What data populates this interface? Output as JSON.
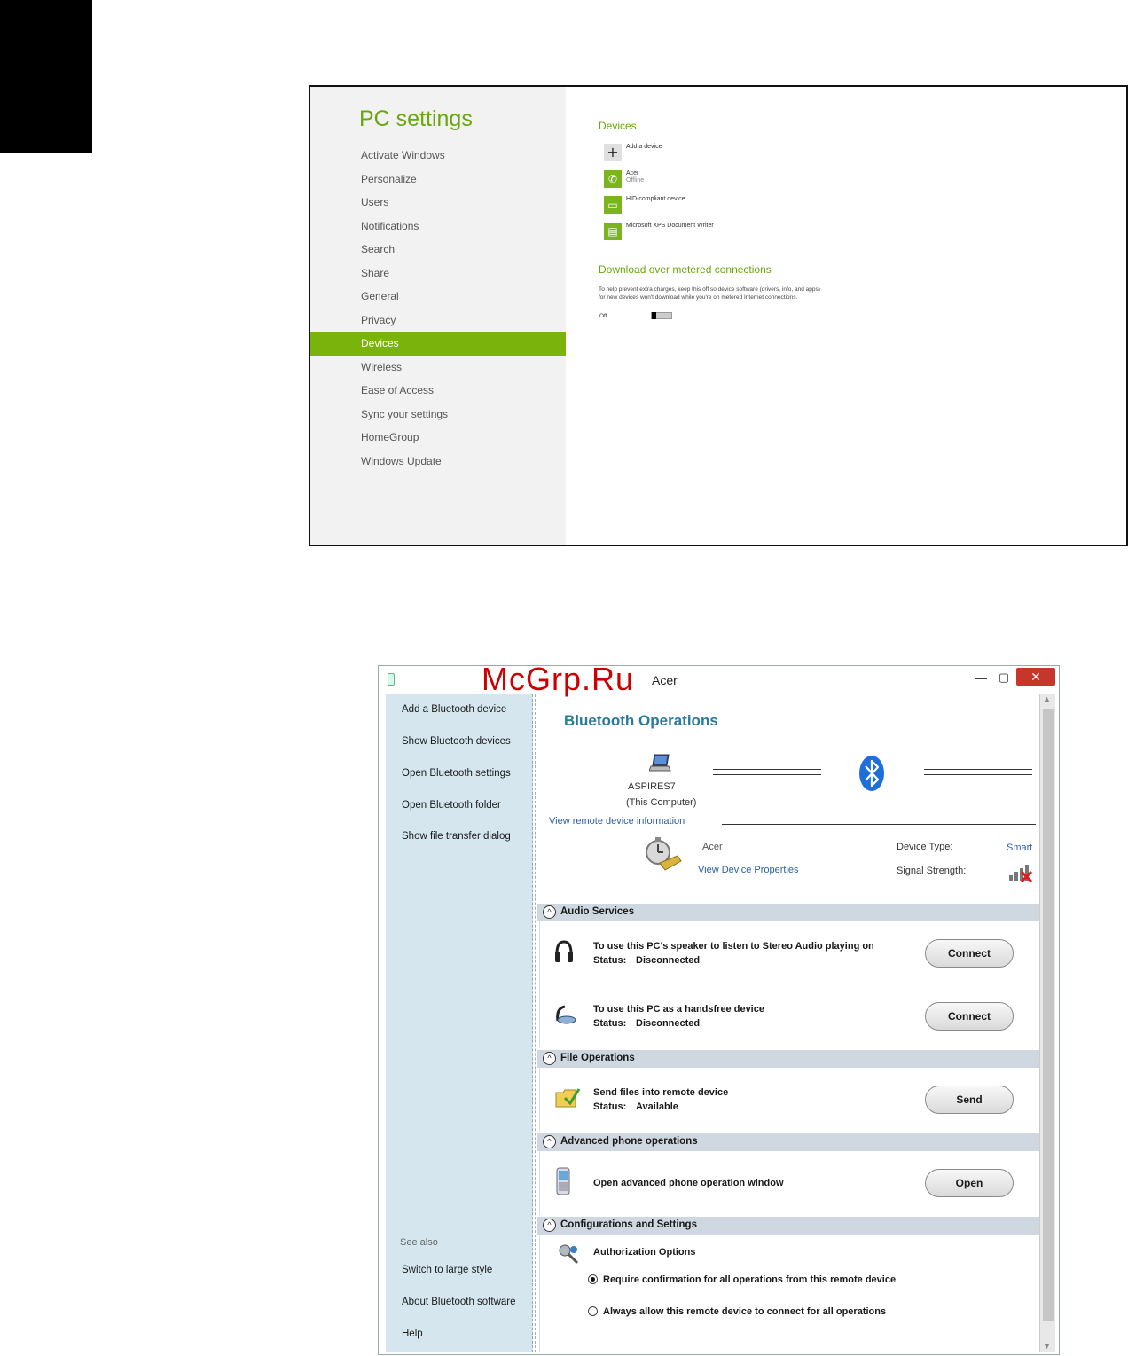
{
  "pc_settings": {
    "title": "PC settings",
    "nav": [
      "Activate Windows",
      "Personalize",
      "Users",
      "Notifications",
      "Search",
      "Share",
      "General",
      "Privacy",
      "Devices",
      "Wireless",
      "Ease of Access",
      "Sync your settings",
      "HomeGroup",
      "Windows Update"
    ],
    "active": "Devices",
    "devices_heading": "Devices",
    "devices": [
      {
        "name": "Add a device",
        "sub": ""
      },
      {
        "name": "Acer",
        "sub": "Offline"
      },
      {
        "name": "HID-compliant device",
        "sub": ""
      },
      {
        "name": "Microsoft XPS Document Writer",
        "sub": ""
      }
    ],
    "metered_heading": "Download over metered connections",
    "metered_text": "To help prevent extra charges, keep this off so device software (drivers, info, and apps) for new devices won't download while you're on metered Internet connections.",
    "toggle_label": "Off"
  },
  "watermark": "McGrp.Ru",
  "bluetooth": {
    "window_title": "Acer",
    "sidebar": {
      "links": [
        "Add a Bluetooth device",
        "Show Bluetooth devices",
        "Open Bluetooth settings",
        "Open Bluetooth folder",
        "Show file transfer dialog"
      ],
      "see_also": "See also",
      "see_also_links": [
        "Switch to large style",
        "About Bluetooth software",
        "Help"
      ]
    },
    "main": {
      "title": "Bluetooth Operations",
      "computer_name": "ASPIRES7",
      "computer_sub": "(This Computer)",
      "remote_info_link": "View remote device information",
      "remote_name": "Acer",
      "device_properties_link": "View Device Properties",
      "device_type_label": "Device Type:",
      "device_type_value": "Smart",
      "signal_label": "Signal Strength:"
    },
    "sections": {
      "audio": {
        "title": "Audio Services",
        "items": [
          {
            "text": "To use this PC's speaker to listen to Stereo Audio playing on",
            "status_label": "Status:",
            "status": "Disconnected",
            "button": "Connect"
          },
          {
            "text": "To use this PC as a handsfree device",
            "status_label": "Status:",
            "status": "Disconnected",
            "button": "Connect"
          }
        ]
      },
      "file": {
        "title": "File Operations",
        "items": [
          {
            "text": "Send files into remote device",
            "status_label": "Status:",
            "status": "Available",
            "button": "Send"
          }
        ]
      },
      "phone": {
        "title": "Advanced phone operations",
        "items": [
          {
            "text": "Open advanced phone operation window",
            "button": "Open"
          }
        ]
      },
      "config": {
        "title": "Configurations and Settings",
        "auth_title": "Authorization Options",
        "options": [
          {
            "label": "Require confirmation for all operations from this remote device",
            "selected": true
          },
          {
            "label": "Always allow this remote device to connect for all operations",
            "selected": false
          }
        ]
      }
    }
  }
}
